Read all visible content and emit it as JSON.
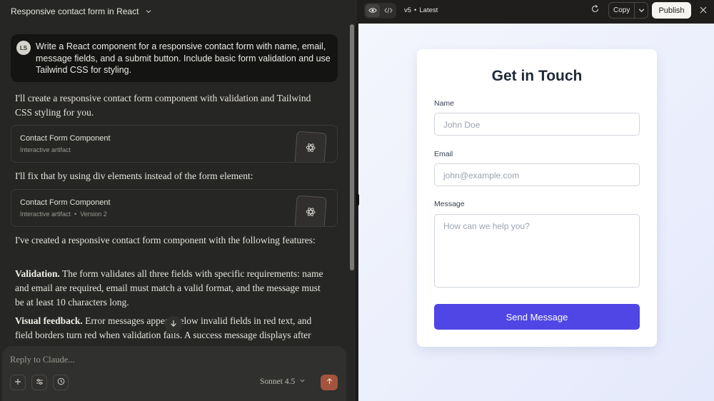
{
  "chat": {
    "title": "Responsive contact form in React",
    "user_initials": "LS",
    "user_message": "Write a React component for a responsive contact form with name, email, message fields, and a submit button. Include basic form validation and use Tailwind CSS for styling.",
    "reply_intro": "I'll create a responsive contact form component with validation and Tailwind CSS styling for you.",
    "artifact1": {
      "title": "Contact Form Component",
      "subtitle": "Interactive artifact"
    },
    "reply_fix": "I'll fix that by using div elements instead of the form element:",
    "artifact2": {
      "title": "Contact Form Component",
      "subtitle": "Interactive artifact",
      "dot": "•",
      "version": "Version 2"
    },
    "features_intro": "I've created a responsive contact form component with the following features:",
    "validation_heading": "Validation.",
    "validation_text": "The form validates all three fields with specific requirements: name and email are required, email must match a valid format, and the message must be at least 10 characters long.",
    "visual_heading": "Visual feedback.",
    "visual_text": "Error messages appear below invalid fields in red text, and field borders turn red when validation fails. A success message displays after",
    "composer_placeholder": "Reply to Claude...",
    "model_label": "Sonnet 4.5"
  },
  "artifact_panel": {
    "version_label": "v5",
    "version_sep": "•",
    "version_status": "Latest",
    "copy_label": "Copy",
    "publish_label": "Publish"
  },
  "form": {
    "title": "Get in Touch",
    "name_label": "Name",
    "name_placeholder": "John Doe",
    "email_label": "Email",
    "email_placeholder": "john@example.com",
    "message_label": "Message",
    "message_placeholder": "How can we help you?",
    "submit_label": "Send Message",
    "accent_color": "#4f46e5"
  },
  "icons": [
    "chevron-down-icon",
    "react-icon",
    "arrow-down-icon",
    "plus-icon",
    "sliders-icon",
    "clock-icon",
    "arrow-up-icon",
    "eye-icon",
    "code-icon",
    "refresh-icon",
    "close-icon"
  ]
}
